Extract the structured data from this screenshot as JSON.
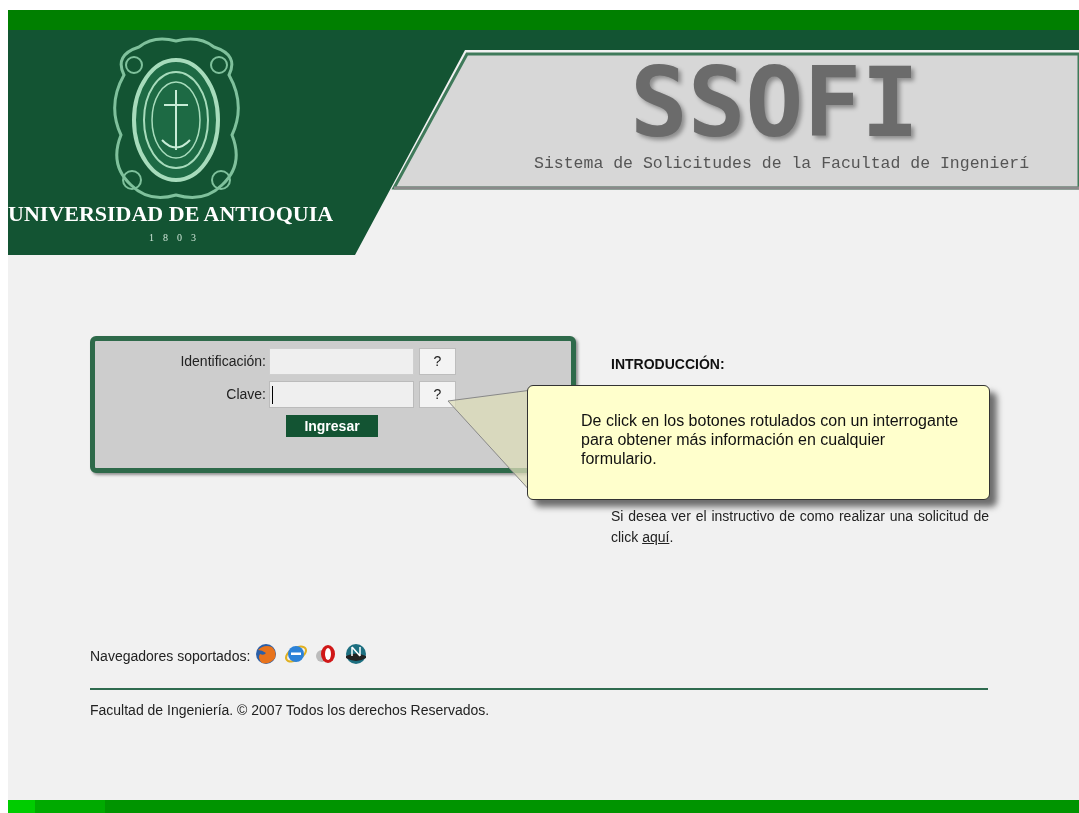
{
  "header": {
    "university": "UNIVERSIDAD DE ANTIOQUIA",
    "year": "1803",
    "title": "SSOFI",
    "subtitle": "Sistema de Solicitudes de la Facultad de Ingenierí"
  },
  "login": {
    "fields": [
      {
        "label": "Identificación:",
        "help": "?",
        "focused": false
      },
      {
        "label": "Clave:",
        "help": "?",
        "focused": true
      }
    ],
    "submit": "Ingresar"
  },
  "intro": {
    "heading": "INTRODUCCIÓN:",
    "text": "Si desea ver el instructivo de como realizar una solicitud de click ",
    "link": "aquí",
    "after": "."
  },
  "tooltip": {
    "text": "De click en los botones rotulados con un interrogante para obtener más información en cualquier formulario."
  },
  "browsers": {
    "label": "Navegadores soportados:",
    "icons": [
      {
        "kind": "orange-globe"
      },
      {
        "kind": "blue-e"
      },
      {
        "kind": "red-o"
      },
      {
        "kind": "teal-n"
      }
    ]
  },
  "footer": {
    "copyright": "Facultad de Ingeniería. © 2007 Todos los derechos Reservados."
  }
}
